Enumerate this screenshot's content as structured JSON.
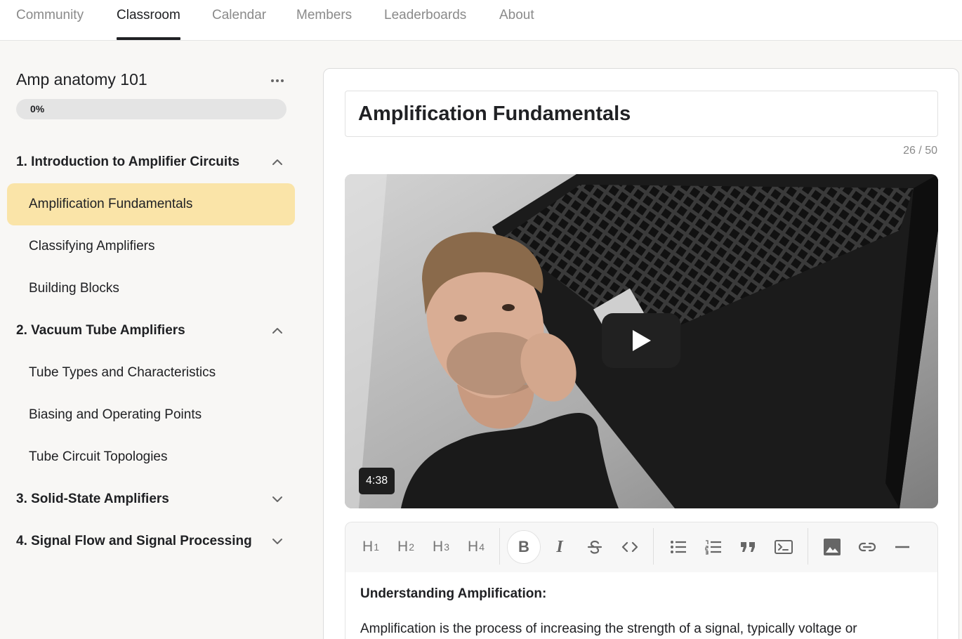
{
  "nav": {
    "tabs": [
      {
        "label": "Community"
      },
      {
        "label": "Classroom"
      },
      {
        "label": "Calendar"
      },
      {
        "label": "Members"
      },
      {
        "label": "Leaderboards"
      },
      {
        "label": "About"
      }
    ],
    "active_tab": "Classroom"
  },
  "course": {
    "title": "Amp anatomy 101",
    "progress_label": "0%",
    "progress_value": 0,
    "more_icon": "ellipsis-icon"
  },
  "modules": [
    {
      "title": "1. Introduction to Amplifier Circuits",
      "expanded": true,
      "lessons": [
        "Amplification Fundamentals",
        "Classifying Amplifiers",
        "Building Blocks"
      ]
    },
    {
      "title": "2. Vacuum Tube Amplifiers",
      "expanded": true,
      "lessons": [
        "Tube Types and Characteristics",
        "Biasing and Operating Points",
        "Tube Circuit Topologies"
      ]
    },
    {
      "title": "3. Solid-State Amplifiers",
      "expanded": false,
      "lessons": []
    },
    {
      "title": "4. Signal Flow and Signal Processing",
      "expanded": false,
      "lessons": []
    }
  ],
  "active_lesson": "Amplification Fundamentals",
  "editor": {
    "title_value": "Amplification Fundamentals",
    "char_count": "26 / 50",
    "video": {
      "duration": "4:38",
      "play_icon": "play-icon"
    },
    "toolbar": {
      "h1": "H",
      "h2": "H",
      "h3": "H",
      "h4": "H",
      "h1_sub": "1",
      "h2_sub": "2",
      "h3_sub": "3",
      "h4_sub": "4",
      "bold": "B",
      "italic": "I"
    },
    "content_heading": "Understanding Amplification:",
    "content_body": "Amplification is the process of increasing the strength of a signal, typically voltage or"
  },
  "colors": {
    "accent": "#fae4a8",
    "background": "#f8f7f5",
    "text": "#202124",
    "muted": "#8a8a8a"
  }
}
